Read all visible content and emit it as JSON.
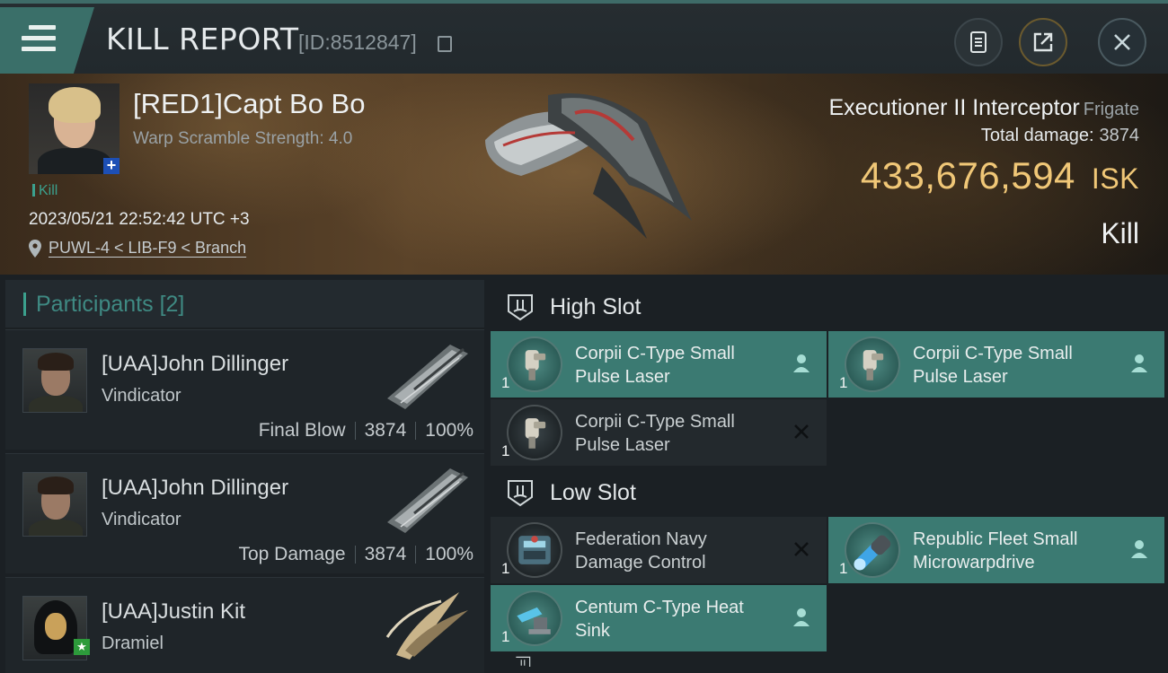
{
  "header": {
    "title": "KILL REPORT",
    "report_id": "[ID:8512847]"
  },
  "victim": {
    "name": "[RED1]Capt Bo Bo",
    "warp_scramble": "Warp Scramble Strength: 4.0",
    "tag": "Kill",
    "timestamp": "2023/05/21 22:52:42 UTC +3",
    "location": "PUWL-4 < LIB-F9 < Branch",
    "ship_name": "Executioner II Interceptor",
    "ship_class": "Frigate",
    "total_damage_label": "Total damage:",
    "total_damage": "3874",
    "isk_value": "433,676,594",
    "isk_unit": "ISK",
    "result": "Kill"
  },
  "participants": {
    "title": "Participants",
    "count": "[2]",
    "items": [
      {
        "name": "[UAA]John Dillinger",
        "ship": "Vindicator",
        "role": "Final Blow",
        "damage": "3874",
        "percent": "100%"
      },
      {
        "name": "[UAA]John Dillinger",
        "ship": "Vindicator",
        "role": "Top Damage",
        "damage": "3874",
        "percent": "100%"
      },
      {
        "name": "[UAA]Justin Kit",
        "ship": "Dramiel",
        "role": "",
        "damage": "",
        "percent": ""
      }
    ]
  },
  "slots": {
    "high": {
      "title": "High Slot",
      "modules": [
        {
          "name": "Corpii C-Type Small Pulse Laser",
          "qty": "1",
          "status": "fitted"
        },
        {
          "name": "Corpii C-Type Small Pulse Laser",
          "qty": "1",
          "status": "fitted"
        },
        {
          "name": "Corpii C-Type Small Pulse Laser",
          "qty": "1",
          "status": "destroyed"
        }
      ]
    },
    "low": {
      "title": "Low Slot",
      "modules": [
        {
          "name": "Federation Navy Damage Control",
          "qty": "1",
          "status": "destroyed"
        },
        {
          "name": "Republic Fleet Small Microwarpdrive",
          "qty": "1",
          "status": "fitted"
        },
        {
          "name": "Centum C-Type Heat Sink",
          "qty": "1",
          "status": "fitted"
        }
      ]
    }
  },
  "colors": {
    "accent_teal": "#3b7a72",
    "isk_gold": "#f0c777",
    "tag_green": "#3ba08d"
  }
}
